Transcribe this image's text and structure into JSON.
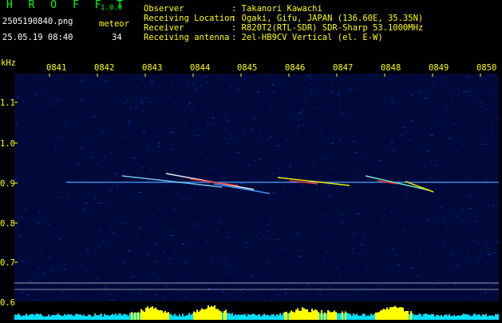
{
  "header": {
    "logo": "H R O F F T",
    "version": "1.0.0",
    "filename": "2505190840.png",
    "meteor_label": "meteor",
    "datetime": "25.05.19 08:40",
    "meteor_count": "34",
    "info": [
      {
        "label": "Observer",
        "value": ": Takanori Kawachi"
      },
      {
        "label": "Receiving Location",
        "value": ": Ogaki, Gifu, JAPAN (136.60E, 35.35N)"
      },
      {
        "label": "Receiver",
        "value": ": R820T2(RTL-SDR) SDR-Sharp 53.1000MHz"
      },
      {
        "label": "Receiving antenna",
        "value": ": 2el-HB9CV Vertical (el. E-W)"
      }
    ]
  },
  "axis": {
    "unit": "kHz",
    "time_ticks": [
      "0841",
      "0842",
      "0843",
      "0844",
      "0845",
      "0846",
      "0847",
      "0848",
      "0849",
      "0850"
    ],
    "freq_ticks": [
      "1.1",
      "1.0",
      "0.9",
      "0.8",
      "0.7",
      "0.6"
    ]
  },
  "colors": {
    "background": "#000000",
    "noise_bg": "#000a3a",
    "carrier": "#4aa0ff",
    "label_yellow": "#ffff00",
    "logo_green": "#00ff00",
    "meteor_hot": "#ff3030",
    "level_cyan": "#00e0ff",
    "level_yellow": "#ffff00"
  }
}
